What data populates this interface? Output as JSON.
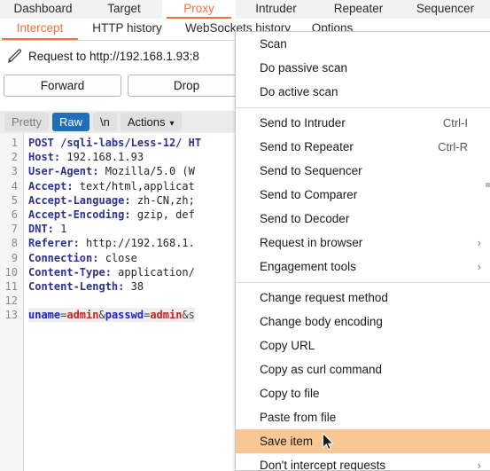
{
  "window": {
    "app": "Burp Suite"
  },
  "main_tabs": [
    {
      "label": "Dashboard",
      "active": false
    },
    {
      "label": "Target",
      "active": false
    },
    {
      "label": "Proxy",
      "active": true
    },
    {
      "label": "Intruder",
      "active": false
    },
    {
      "label": "Repeater",
      "active": false
    },
    {
      "label": "Sequencer",
      "active": false
    }
  ],
  "sub_tabs": [
    {
      "label": "Intercept",
      "active": true
    },
    {
      "label": "HTTP history",
      "active": false
    },
    {
      "label": "WebSockets history",
      "active": false
    },
    {
      "label": "Options",
      "active": false
    }
  ],
  "request_bar": {
    "icon": "pencil-icon",
    "text": "Request to http://192.168.1.93:8"
  },
  "actions": {
    "forward": "Forward",
    "drop": "Drop"
  },
  "editor_toolbar": {
    "pretty": "Pretty",
    "raw": "Raw",
    "newline": "\\n",
    "actions": "Actions",
    "caret": "⌄",
    "selected": "Raw",
    "selected_color": "#1f6fba"
  },
  "request": {
    "lines": [
      {
        "no": "1",
        "type": "request-line",
        "text": "POST /sqli-labs/Less-12/ HT"
      },
      {
        "no": "2",
        "type": "header",
        "name": "Host:",
        "value": " 192.168.1.93"
      },
      {
        "no": "3",
        "type": "header",
        "name": "User-Agent:",
        "value": " Mozilla/5.0 (W"
      },
      {
        "no": "4",
        "type": "header",
        "name": "Accept:",
        "value": " text/html,applicat"
      },
      {
        "no": "5",
        "type": "header",
        "name": "Accept-Language:",
        "value": " zh-CN,zh;"
      },
      {
        "no": "6",
        "type": "header",
        "name": "Accept-Encoding:",
        "value": " gzip, def"
      },
      {
        "no": "7",
        "type": "header",
        "name": "DNT:",
        "value": " 1"
      },
      {
        "no": "8",
        "type": "header",
        "name": "Referer:",
        "value": " http://192.168.1."
      },
      {
        "no": "9",
        "type": "header",
        "name": "Connection:",
        "value": " close"
      },
      {
        "no": "10",
        "type": "header",
        "name": "Content-Type:",
        "value": " application/"
      },
      {
        "no": "11",
        "type": "header",
        "name": "Content-Length:",
        "value": " 38"
      },
      {
        "no": "12",
        "type": "blank",
        "text": ""
      },
      {
        "no": "13",
        "type": "body",
        "text": "uname=admin&passwd=admin&s"
      }
    ],
    "body_params": [
      {
        "name": "uname",
        "value": "admin"
      },
      {
        "name": "passwd",
        "value": "admin"
      }
    ],
    "body_trailing": "&s"
  },
  "context_menu": {
    "items": [
      {
        "label": "Scan",
        "accel": "",
        "submenu": false,
        "highlight": false,
        "sep_after": false
      },
      {
        "label": "Do passive scan",
        "accel": "",
        "submenu": false,
        "highlight": false,
        "sep_after": false
      },
      {
        "label": "Do active scan",
        "accel": "",
        "submenu": false,
        "highlight": false,
        "sep_after": true
      },
      {
        "label": "Send to Intruder",
        "accel": "Ctrl-I",
        "submenu": false,
        "highlight": false,
        "sep_after": false
      },
      {
        "label": "Send to Repeater",
        "accel": "Ctrl-R",
        "submenu": false,
        "highlight": false,
        "sep_after": false
      },
      {
        "label": "Send to Sequencer",
        "accel": "",
        "submenu": false,
        "highlight": false,
        "sep_after": false
      },
      {
        "label": "Send to Comparer",
        "accel": "",
        "submenu": false,
        "highlight": false,
        "sep_after": false
      },
      {
        "label": "Send to Decoder",
        "accel": "",
        "submenu": false,
        "highlight": false,
        "sep_after": false
      },
      {
        "label": "Request in browser",
        "accel": "",
        "submenu": true,
        "highlight": false,
        "sep_after": false
      },
      {
        "label": "Engagement tools",
        "accel": "",
        "submenu": true,
        "highlight": false,
        "sep_after": true
      },
      {
        "label": "Change request method",
        "accel": "",
        "submenu": false,
        "highlight": false,
        "sep_after": false
      },
      {
        "label": "Change body encoding",
        "accel": "",
        "submenu": false,
        "highlight": false,
        "sep_after": false
      },
      {
        "label": "Copy URL",
        "accel": "",
        "submenu": false,
        "highlight": false,
        "sep_after": false
      },
      {
        "label": "Copy as curl command",
        "accel": "",
        "submenu": false,
        "highlight": false,
        "sep_after": false
      },
      {
        "label": "Copy to file",
        "accel": "",
        "submenu": false,
        "highlight": false,
        "sep_after": false
      },
      {
        "label": "Paste from file",
        "accel": "",
        "submenu": false,
        "highlight": false,
        "sep_after": false
      },
      {
        "label": "Save item",
        "accel": "",
        "submenu": false,
        "highlight": true,
        "sep_after": false
      },
      {
        "label": "Don't intercept requests",
        "accel": "",
        "submenu": true,
        "highlight": false,
        "sep_after": false
      }
    ],
    "submenu_glyph": "›",
    "highlight_color": "#f9c794"
  },
  "colors": {
    "accent_orange": "#f4713b",
    "selected_blue": "#1f6fba",
    "menu_highlight": "#f9c794",
    "header_name": "#2e3192",
    "param_name": "#2020cc",
    "param_value": "#cc2222"
  }
}
